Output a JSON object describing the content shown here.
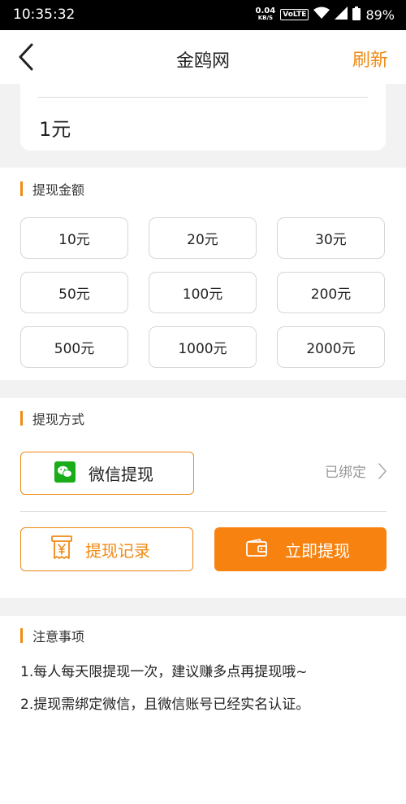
{
  "status_bar": {
    "time": "10:35:32",
    "net_speed_value": "0.04",
    "net_speed_unit": "KB/S",
    "volte": "VoLTE",
    "battery": "89%"
  },
  "nav": {
    "title": "金鸥网",
    "refresh_label": "刷新"
  },
  "amount_card": {
    "value": "1元"
  },
  "withdraw_amount": {
    "title": "提现金额",
    "options": [
      "10元",
      "20元",
      "30元",
      "50元",
      "100元",
      "200元",
      "500元",
      "1000元",
      "2000元"
    ]
  },
  "withdraw_method": {
    "title": "提现方式",
    "wechat_label": "微信提现",
    "bind_status": "已绑定"
  },
  "actions": {
    "records_label": "提现记录",
    "withdraw_label": "立即提现"
  },
  "notes": {
    "title": "注意事项",
    "items": [
      "1.每人每天限提现一次，建议赚多点再提现哦~",
      "2.提现需绑定微信，且微信账号已经实名认证。"
    ]
  },
  "colors": {
    "accent": "#f08a14",
    "primary_button": "#f7820f",
    "wechat_green": "#1aad19",
    "section_gap": "#f2f2f2"
  }
}
